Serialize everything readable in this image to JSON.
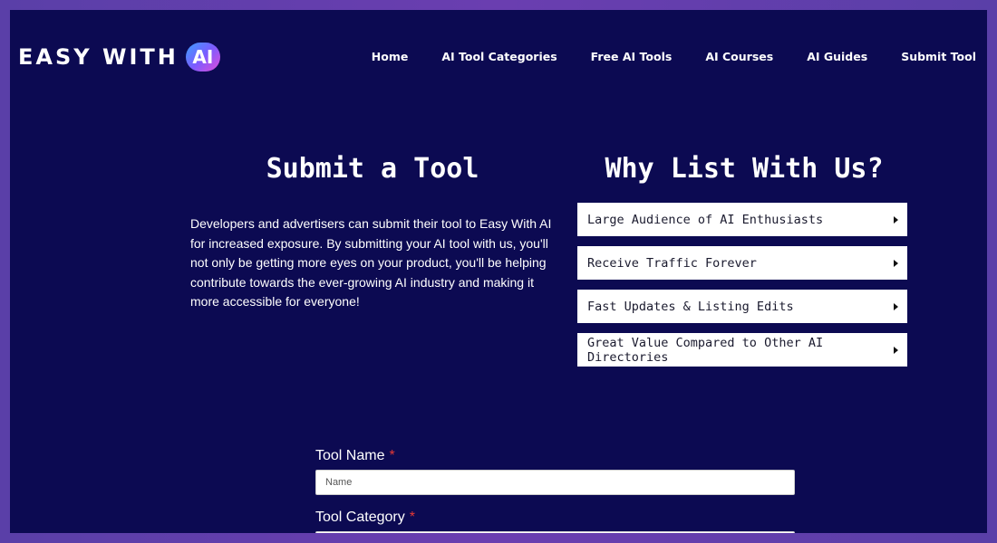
{
  "header": {
    "logo_text": "EASY WITH",
    "logo_badge": "AI",
    "nav": [
      {
        "label": "Home"
      },
      {
        "label": "AI Tool Categories"
      },
      {
        "label": "Free AI Tools"
      },
      {
        "label": "AI Courses"
      },
      {
        "label": "AI Guides"
      },
      {
        "label": "Submit Tool"
      }
    ]
  },
  "submit": {
    "title": "Submit a Tool",
    "intro": "Developers and advertisers can submit their tool to Easy With AI for increased exposure. By submitting your AI tool with us, you'll not only be getting more eyes on your product, you'll be helping contribute towards the ever-growing AI industry and making it more accessible for everyone!"
  },
  "why": {
    "title": "Why List With Us?",
    "items": [
      {
        "label": "Large Audience of AI Enthusiasts"
      },
      {
        "label": "Receive Traffic Forever"
      },
      {
        "label": "Fast Updates & Listing Edits"
      },
      {
        "label": "Great Value Compared to Other AI Directories"
      }
    ]
  },
  "form": {
    "tool_name_label": "Tool Name",
    "tool_name_placeholder": "Name",
    "tool_category_label": "Tool Category",
    "required_mark": "*"
  },
  "colors": {
    "background": "#0c0a52",
    "outer": "#5a3fa8",
    "required": "#e53935"
  }
}
